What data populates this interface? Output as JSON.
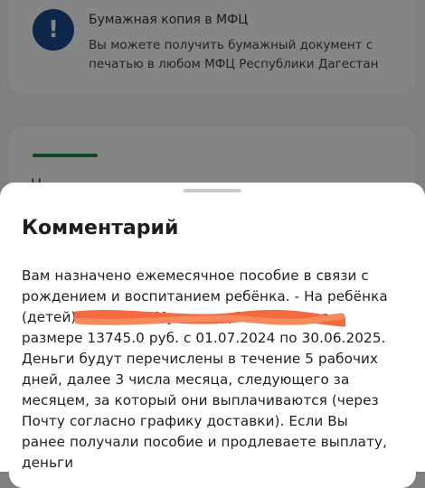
{
  "background": {
    "mfc_card": {
      "icon": "exclamation-icon",
      "icon_glyph": "!",
      "title": "Бумажная копия в МФЦ",
      "description": "Вы можете получить бумажный документ с печатью в любом МФЦ Республики Дагестан"
    },
    "second_card": {
      "partial_text": "Н"
    }
  },
  "sheet": {
    "title": "Комментарий",
    "comment": "Вам назначено ежемесячное пособие в связи с рождением и воспитанием ребёнка. - На ребёнка (детей): Гаджиев Мухаммад Рашидович в размере 13745.0 руб. с 01.07.2024 по 30.06.2025. Деньги будут перечислены в течение 5 рабочих дней, далее 3 числа месяца, следующего за месяцем, за который они выплачиваются (через Почту согласно графику доставки). Если Вы ранее получали пособие и продлеваете выплату, деньги"
  },
  "colors": {
    "accent_green": "#1f8a3a",
    "icon_blue": "#1a4a8c",
    "redaction_orange": "#f26a3d"
  }
}
